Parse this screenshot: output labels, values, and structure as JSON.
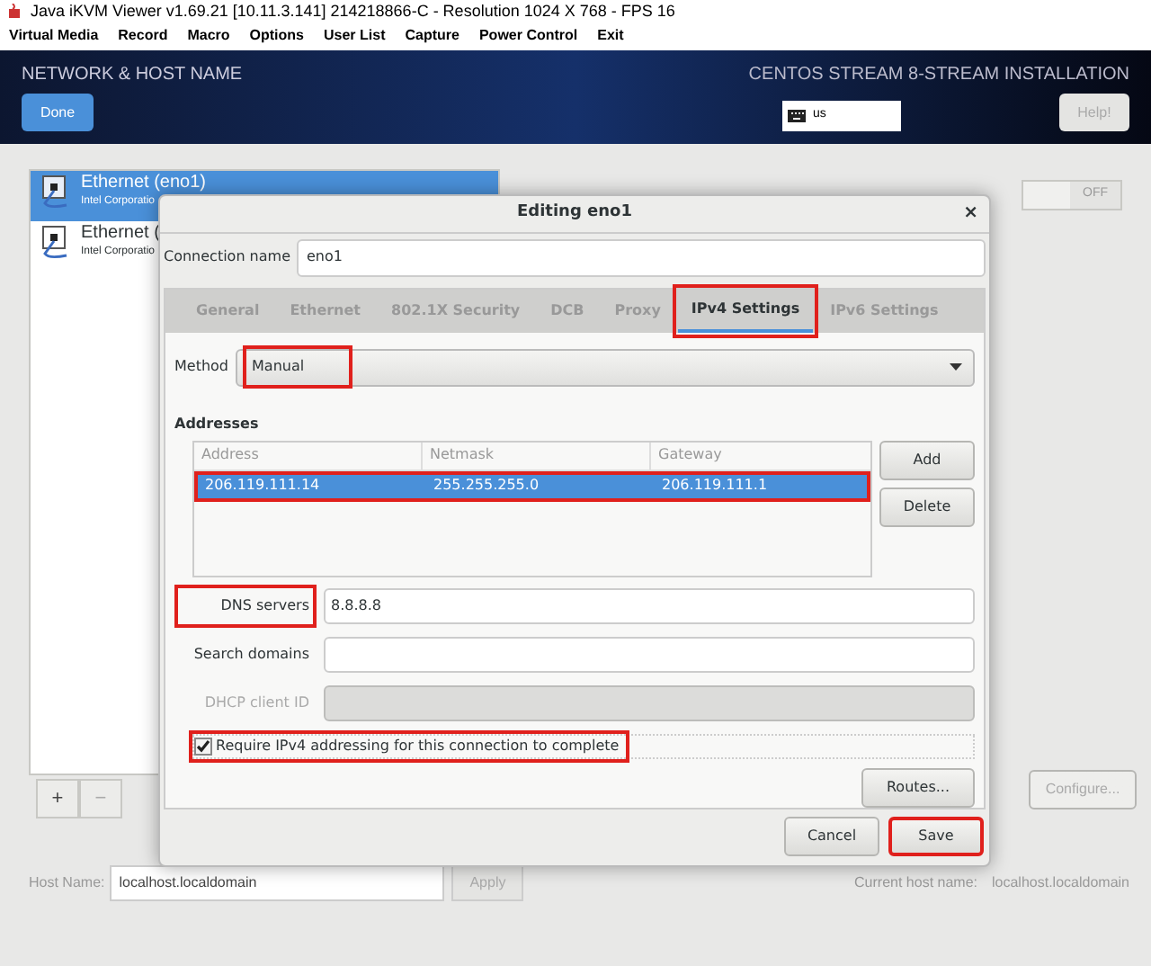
{
  "window": {
    "title": "Java iKVM Viewer v1.69.21 [10.11.3.141] 214218866-C - Resolution 1024 X 768 - FPS 16"
  },
  "menu": [
    "Virtual Media",
    "Record",
    "Macro",
    "Options",
    "User List",
    "Capture",
    "Power Control",
    "Exit"
  ],
  "header": {
    "title": "NETWORK & HOST NAME",
    "done": "Done",
    "product": "CENTOS STREAM 8-STREAM INSTALLATION",
    "keyboard": "us",
    "help": "Help!"
  },
  "devices": [
    {
      "name": "Ethernet (eno1)",
      "vendor": "Intel Corporatio",
      "selected": true
    },
    {
      "name": "Ethernet (",
      "vendor": "Intel Corporatio",
      "selected": false
    }
  ],
  "toggle": {
    "label": "OFF",
    "on": false
  },
  "list_buttons": [
    "+",
    "−"
  ],
  "configure": "Configure...",
  "hostname": {
    "label": "Host Name:",
    "value": "localhost.localdomain",
    "apply": "Apply",
    "current_label": "Current host name:",
    "current_value": "localhost.localdomain"
  },
  "dialog": {
    "title": "Editing eno1",
    "close": "×",
    "connection_name": {
      "label": "Connection name",
      "value": "eno1"
    },
    "tabs": [
      {
        "label": "General",
        "selected": false,
        "highlighted": false
      },
      {
        "label": "Ethernet",
        "selected": false,
        "highlighted": false
      },
      {
        "label": "802.1X Security",
        "selected": false,
        "highlighted": false
      },
      {
        "label": "DCB",
        "selected": false,
        "highlighted": false
      },
      {
        "label": "Proxy",
        "selected": false,
        "highlighted": false
      },
      {
        "label": "IPv4 Settings",
        "selected": true,
        "highlighted": true
      },
      {
        "label": "IPv6 Settings",
        "selected": false,
        "highlighted": false
      }
    ],
    "method": {
      "label": "Method",
      "value": "Manual",
      "highlighted": true
    },
    "addresses": {
      "title": "Addresses",
      "columns": [
        "Address",
        "Netmask",
        "Gateway"
      ],
      "rows": [
        {
          "cells": [
            "206.119.111.14",
            "255.255.255.0",
            "206.119.111.1"
          ],
          "selected": true,
          "highlighted": true
        }
      ],
      "buttons": [
        "Add",
        "Delete"
      ]
    },
    "fields": [
      {
        "label": "DNS servers",
        "value": "8.8.8.8",
        "disabled": false,
        "highlighted": true
      },
      {
        "label": "Search domains",
        "disabled": false,
        "highlighted": false
      },
      {
        "label": "DHCP client ID",
        "disabled": true,
        "highlighted": false
      }
    ],
    "require": {
      "label": "Require IPv4 addressing for this connection to complete",
      "checked": true,
      "highlighted": true
    },
    "routes": "Routes...",
    "buttons": [
      {
        "label": "Cancel",
        "highlighted": false
      },
      {
        "label": "Save",
        "highlighted": true
      }
    ]
  }
}
